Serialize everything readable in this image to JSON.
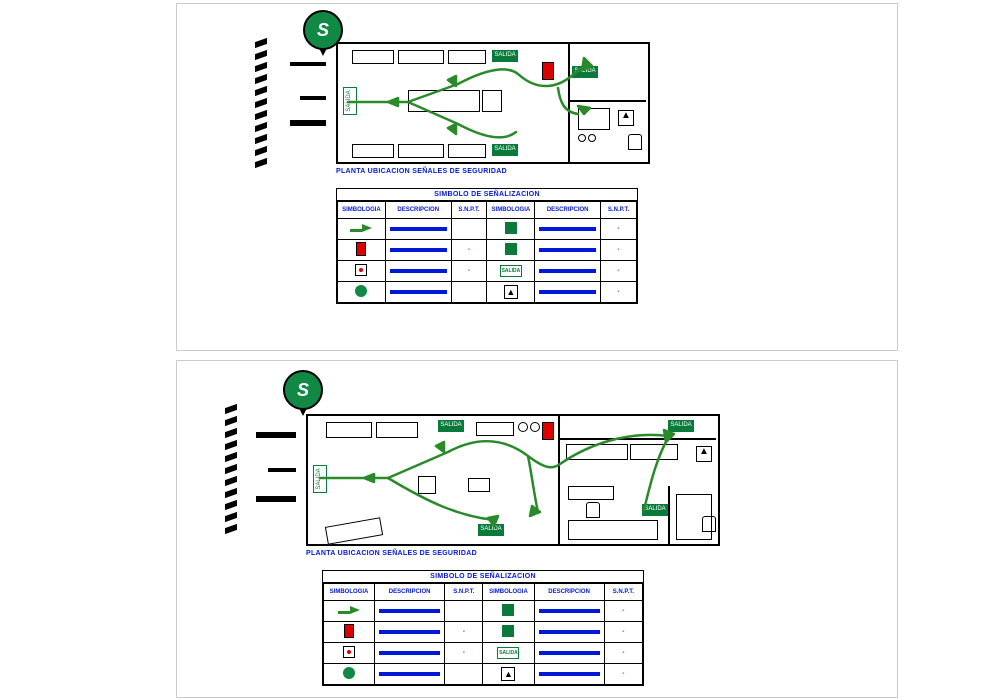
{
  "north_label": "S",
  "plan_caption": "PLANTA UBICACION SEÑALES DE SEGURIDAD",
  "salida_label": "SALIDA",
  "legend": {
    "title": "SIMBOLO DE SEÑALIZACION",
    "headers": {
      "sym": "SIMBOLOGIA",
      "desc": "DESCRIPCION",
      "snpt": "S.N.P.T."
    },
    "rows_left": [
      {
        "sym": "arrow",
        "desc": "DIRECCION DE EVACUACION",
        "snpt": ""
      },
      {
        "sym": "ext",
        "desc": "EXTINTOR DE INCENDIO",
        "snpt": "-"
      },
      {
        "sym": "bot",
        "desc": "BOTIQUIN",
        "snpt": "-"
      },
      {
        "sym": "zona",
        "desc": "ZONA SEGURA",
        "snpt": ""
      }
    ],
    "rows_right": [
      {
        "sym": "greensq",
        "desc": "SEÑAL DE SALIDA",
        "snpt": "-"
      },
      {
        "sym": "greensq",
        "desc": "RUTA DE EVACUACION",
        "snpt": "-"
      },
      {
        "sym": "salida",
        "desc": "SALIDA",
        "snpt": "-"
      },
      {
        "sym": "riesgo",
        "desc": "RIESGO ELECTRICO",
        "snpt": "-"
      }
    ]
  }
}
